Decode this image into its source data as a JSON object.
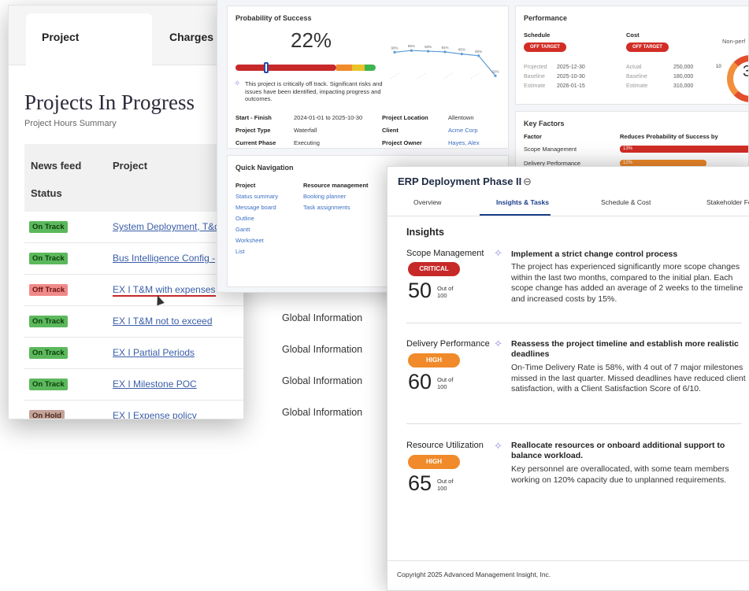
{
  "projects_window": {
    "tabs": [
      "Project",
      "Charges"
    ],
    "title": "Projects In Progress",
    "subtitle": "Project Hours Summary",
    "columns": {
      "newsfeed": "News feed",
      "status": "Status",
      "project": "Project"
    },
    "rows": [
      {
        "status": "On Track",
        "status_color": "#5cb85c",
        "project": "System Deployment, T&d"
      },
      {
        "status": "On Track",
        "status_color": "#5cb85c",
        "project": "Bus Intelligence Config -"
      },
      {
        "status": "Off Track",
        "status_color": "#f08a8a",
        "project": "EX I T&M with expenses"
      },
      {
        "status": "On Track",
        "status_color": "#5cb85c",
        "project": "EX I T&M not to exceed",
        "client": "Global Information"
      },
      {
        "status": "On Track",
        "status_color": "#5cb85c",
        "project": "EX I Partial Periods",
        "client": "Global Information"
      },
      {
        "status": "On Track",
        "status_color": "#5cb85c",
        "project": "EX I Milestone POC",
        "client": "Global Information"
      },
      {
        "status": "On Hold",
        "status_color": "#c4a39a",
        "project": "EX I Expense policy",
        "client": "Global Information"
      }
    ]
  },
  "dashboard_window": {
    "probability": {
      "title": "Probability of Success",
      "value": "22%",
      "progress": 0.22,
      "note": "This project is critically off track. Significant risks and issues have been identified, impacting progress and outcomes.",
      "sparkline_labels": [
        "90%",
        "95%",
        "93%",
        "91%",
        "85%",
        "80%",
        "22%"
      ]
    },
    "details": {
      "start_finish_label": "Start - Finish",
      "start_finish": "2024-01-01 to 2025-10-30",
      "project_type_label": "Project Type",
      "project_type": "Waterfall",
      "current_phase_label": "Current Phase",
      "current_phase": "Executing",
      "location_label": "Project Location",
      "location": "Allentown",
      "client_label": "Client",
      "client": "Acme Corp",
      "owner_label": "Project Owner",
      "owner": "Hayes, Alex"
    },
    "quick_nav": {
      "title": "Quick Navigation",
      "project_heading": "Project",
      "project_links": [
        "Status summary",
        "Message board",
        "Outline",
        "Gantt",
        "Worksheet",
        "List"
      ],
      "resource_heading": "Resource management",
      "resource_links": [
        "Booking planner",
        "Task assignments"
      ]
    },
    "performance": {
      "title": "Performance",
      "schedule": {
        "label": "Schedule",
        "badge": "OFF TARGET",
        "rows": [
          [
            "Projected",
            "2025-12-30"
          ],
          [
            "Baseline",
            "2025-10-30"
          ],
          [
            "Estimate",
            "2026-01-15"
          ]
        ]
      },
      "cost": {
        "label": "Cost",
        "badge": "OFF TARGET",
        "rows": [
          [
            "Actual",
            "250,000"
          ],
          [
            "Baseline",
            "180,000"
          ],
          [
            "Estimate",
            "310,000"
          ]
        ]
      },
      "nonperf_label": "Non-perf",
      "gauge_value": "3",
      "gauge_tick": "10"
    },
    "key_factors": {
      "title": "Key Factors",
      "col_factor": "Factor",
      "col_reduce": "Reduces Probability of Success by",
      "rows": [
        {
          "factor": "Scope Management",
          "value": "13%",
          "color": "#d12d26"
        },
        {
          "factor": "Delivery Performance",
          "value": "12%",
          "color": "#f08a2a"
        }
      ]
    }
  },
  "erp_window": {
    "title": "ERP Deployment Phase II",
    "tabs": [
      "Overview",
      "Insights & Tasks",
      "Schedule & Cost",
      "Stakeholder Fe"
    ],
    "active_tab": "Insights & Tasks",
    "section_title": "Insights",
    "insights": [
      {
        "metric": "Scope Management",
        "level": "CRITICAL",
        "level_color": "#c72929",
        "score": "50",
        "out_of": "Out of",
        "max": "100",
        "rec_title": "Implement a strict change control process",
        "rec_body": "The project has experienced significantly more scope changes within the last two months, compared to the initial plan. Each scope change has added an average of 2 weeks to the timeline and increased costs by 15%."
      },
      {
        "metric": "Delivery Performance",
        "level": "HIGH",
        "level_color": "#f08a2a",
        "score": "60",
        "out_of": "Out of",
        "max": "100",
        "rec_title": "Reassess the project timeline and establish more realistic deadlines",
        "rec_body": "On-Time Delivery Rate is 58%, with 4 out of 7 major milestones missed in the last quarter. Missed deadlines have reduced client satisfaction, with a Client Satisfaction Score of 6/10."
      },
      {
        "metric": "Resource Utilization",
        "level": "HIGH",
        "level_color": "#f08a2a",
        "score": "65",
        "out_of": "Out of",
        "max": "100",
        "rec_title": "Reallocate resources or onboard additional support to balance workload.",
        "rec_body": "Key personnel are overallocated, with some team members working on 120% capacity due to unplanned requirements."
      }
    ],
    "footer": "Copyright 2025 Advanced Management Insight, Inc."
  }
}
